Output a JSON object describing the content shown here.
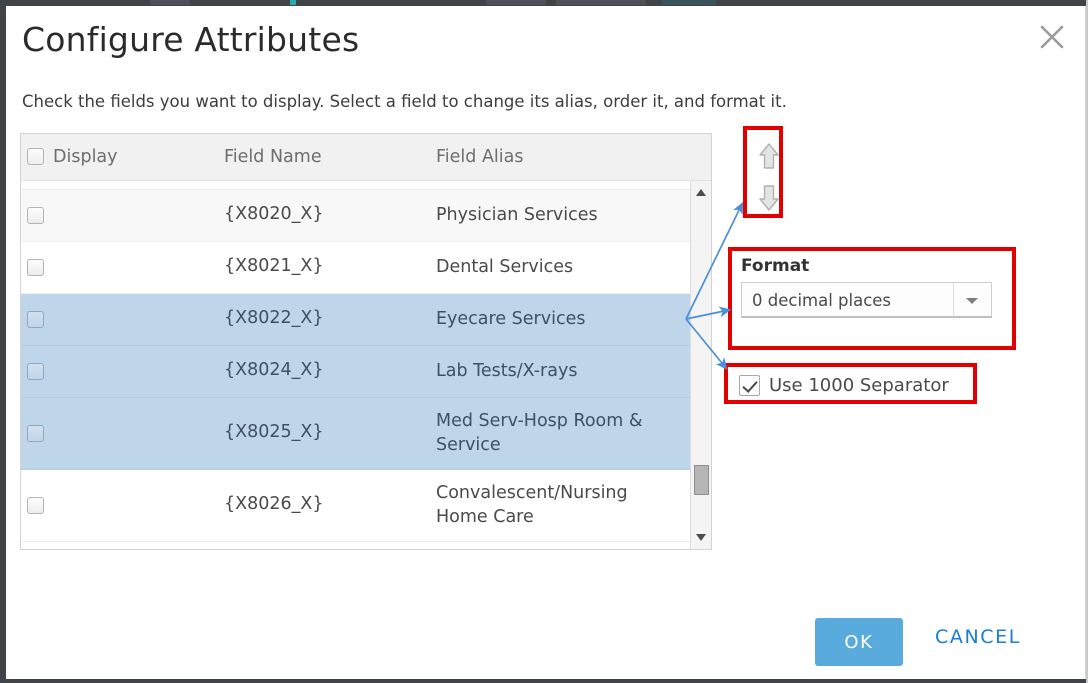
{
  "dialog": {
    "title": "Configure Attributes",
    "subtitle": "Check the fields you want to display. Select a field to change its alias, order it, and format it.",
    "close_icon": "close-icon"
  },
  "list": {
    "columns": {
      "display": "Display",
      "field_name": "Field Name",
      "field_alias": "Field Alias"
    },
    "header_checkbox_checked": false,
    "rows": [
      {
        "field_name": "{X8020_X}",
        "field_alias": "Physician Services",
        "checked": false,
        "selected": false,
        "stripe": "alt"
      },
      {
        "field_name": "{X8021_X}",
        "field_alias": "Dental Services",
        "checked": false,
        "selected": false,
        "stripe": "plain"
      },
      {
        "field_name": "{X8022_X}",
        "field_alias": "Eyecare Services",
        "checked": false,
        "selected": true,
        "stripe": "alt"
      },
      {
        "field_name": "{X8024_X}",
        "field_alias": "Lab Tests/X-rays",
        "checked": false,
        "selected": true,
        "stripe": "plain"
      },
      {
        "field_name": "{X8025_X}",
        "field_alias": "Med Serv-Hosp Room & Service",
        "checked": false,
        "selected": true,
        "stripe": "alt"
      },
      {
        "field_name": "{X8026_X}",
        "field_alias": "Convalescent/Nursing Home Care",
        "checked": false,
        "selected": false,
        "stripe": "plain"
      }
    ],
    "scrollbar": {
      "up_icon": "scroll-up-arrow-icon",
      "down_icon": "scroll-down-arrow-icon",
      "thumb": "scrollbar-thumb"
    }
  },
  "order_controls": {
    "move_up_icon": "move-up-arrow-icon",
    "move_down_icon": "move-down-arrow-icon"
  },
  "format": {
    "label": "Format",
    "selected_option": "0 decimal places",
    "options": [
      "0 decimal places"
    ],
    "caret_icon": "chevron-down-icon"
  },
  "separator": {
    "label": "Use 1000 Separator",
    "checked": true
  },
  "footer": {
    "ok_label": "OK",
    "cancel_label": "CANCEL"
  },
  "colors": {
    "annotation_red": "#e00000",
    "annotation_blue": "#4a90d9",
    "selection_blue": "#bed5ea",
    "primary_button": "#59aadd",
    "link_blue": "#1a7fd4"
  }
}
